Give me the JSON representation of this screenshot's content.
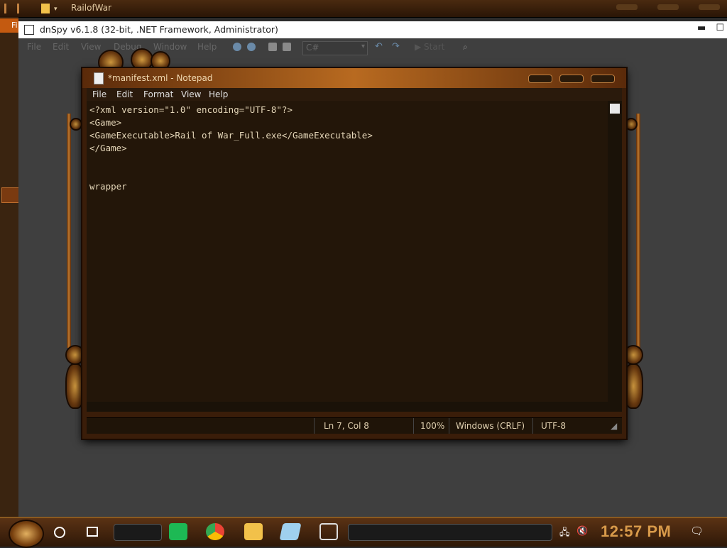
{
  "explorer": {
    "title": "RailofWar"
  },
  "left_window": {
    "tab_label": "Fi"
  },
  "dnspy": {
    "title": "dnSpy v6.1.8 (32-bit, .NET Framework, Administrator)",
    "menu": [
      "File",
      "Edit",
      "View",
      "Debug",
      "Window",
      "Help"
    ],
    "language": "C#",
    "start_label": "Start",
    "controls": {
      "minimize": "▬",
      "maximize": "☐"
    }
  },
  "notepad": {
    "title": "*manifest.xml - Notepad",
    "menu": [
      "File",
      "Edit",
      "Format",
      "View",
      "Help"
    ],
    "lines": [
      "<?xml version=\"1.0\" encoding=\"UTF-8\"?>",
      "<Game>",
      "<GameExecutable>Rail of War_Full.exe</GameExecutable>",
      "</Game>",
      "",
      "",
      "wrapper"
    ],
    "status": {
      "position": "Ln 7, Col 8",
      "zoom": "100%",
      "line_ending": "Windows (CRLF)",
      "encoding": "UTF-8"
    }
  },
  "taskbar": {
    "apps": [
      "spotify-icon",
      "chrome-icon",
      "file-explorer-icon",
      "notepad-icon",
      "dnspy-icon"
    ],
    "clock": "12:57 PM"
  },
  "colors": {
    "accent": "#d89a4a",
    "wood": "#3a1d09",
    "editor_bg": "#231609"
  }
}
